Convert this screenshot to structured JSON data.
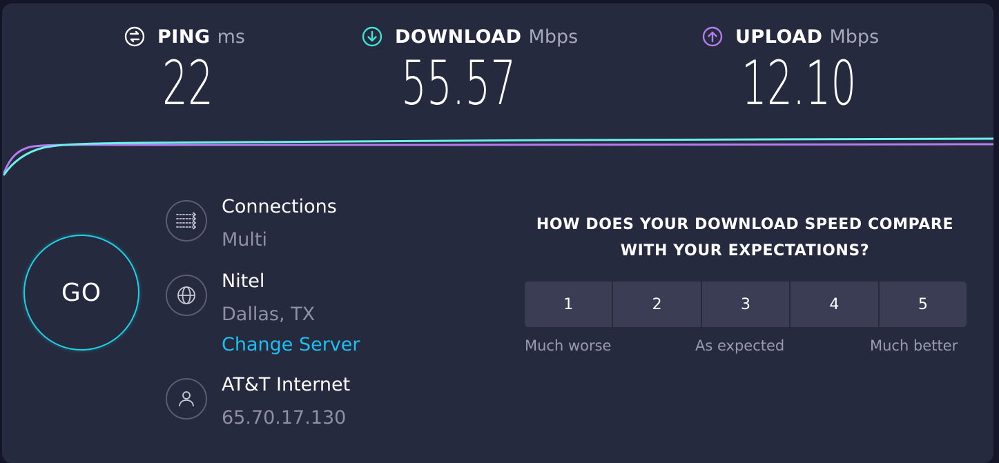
{
  "metrics": {
    "ping": {
      "label": "PING",
      "unit": "ms",
      "value": "22"
    },
    "download": {
      "label": "DOWNLOAD",
      "unit": "Mbps",
      "value": "55.57"
    },
    "upload": {
      "label": "UPLOAD",
      "unit": "Mbps",
      "value": "12.10"
    }
  },
  "go_button": {
    "label": "GO"
  },
  "connections": {
    "label": "Connections",
    "value": "Multi",
    "icon": "connections-icon"
  },
  "server": {
    "name": "Nitel",
    "location": "Dallas, TX",
    "change_link": "Change Server",
    "icon": "globe-icon"
  },
  "isp": {
    "name": "AT&T Internet",
    "ip": "65.70.17.130",
    "icon": "user-icon"
  },
  "survey": {
    "question_line1": "HOW DOES YOUR DOWNLOAD SPEED COMPARE",
    "question_line2": "WITH YOUR EXPECTATIONS?",
    "ratings": [
      "1",
      "2",
      "3",
      "4",
      "5"
    ],
    "label_low": "Much worse",
    "label_mid": "As expected",
    "label_high": "Much better"
  },
  "colors": {
    "background": "#262a3e",
    "download_accent": "#3fe3d6",
    "upload_accent": "#b57cf0",
    "link": "#1fbef0"
  }
}
